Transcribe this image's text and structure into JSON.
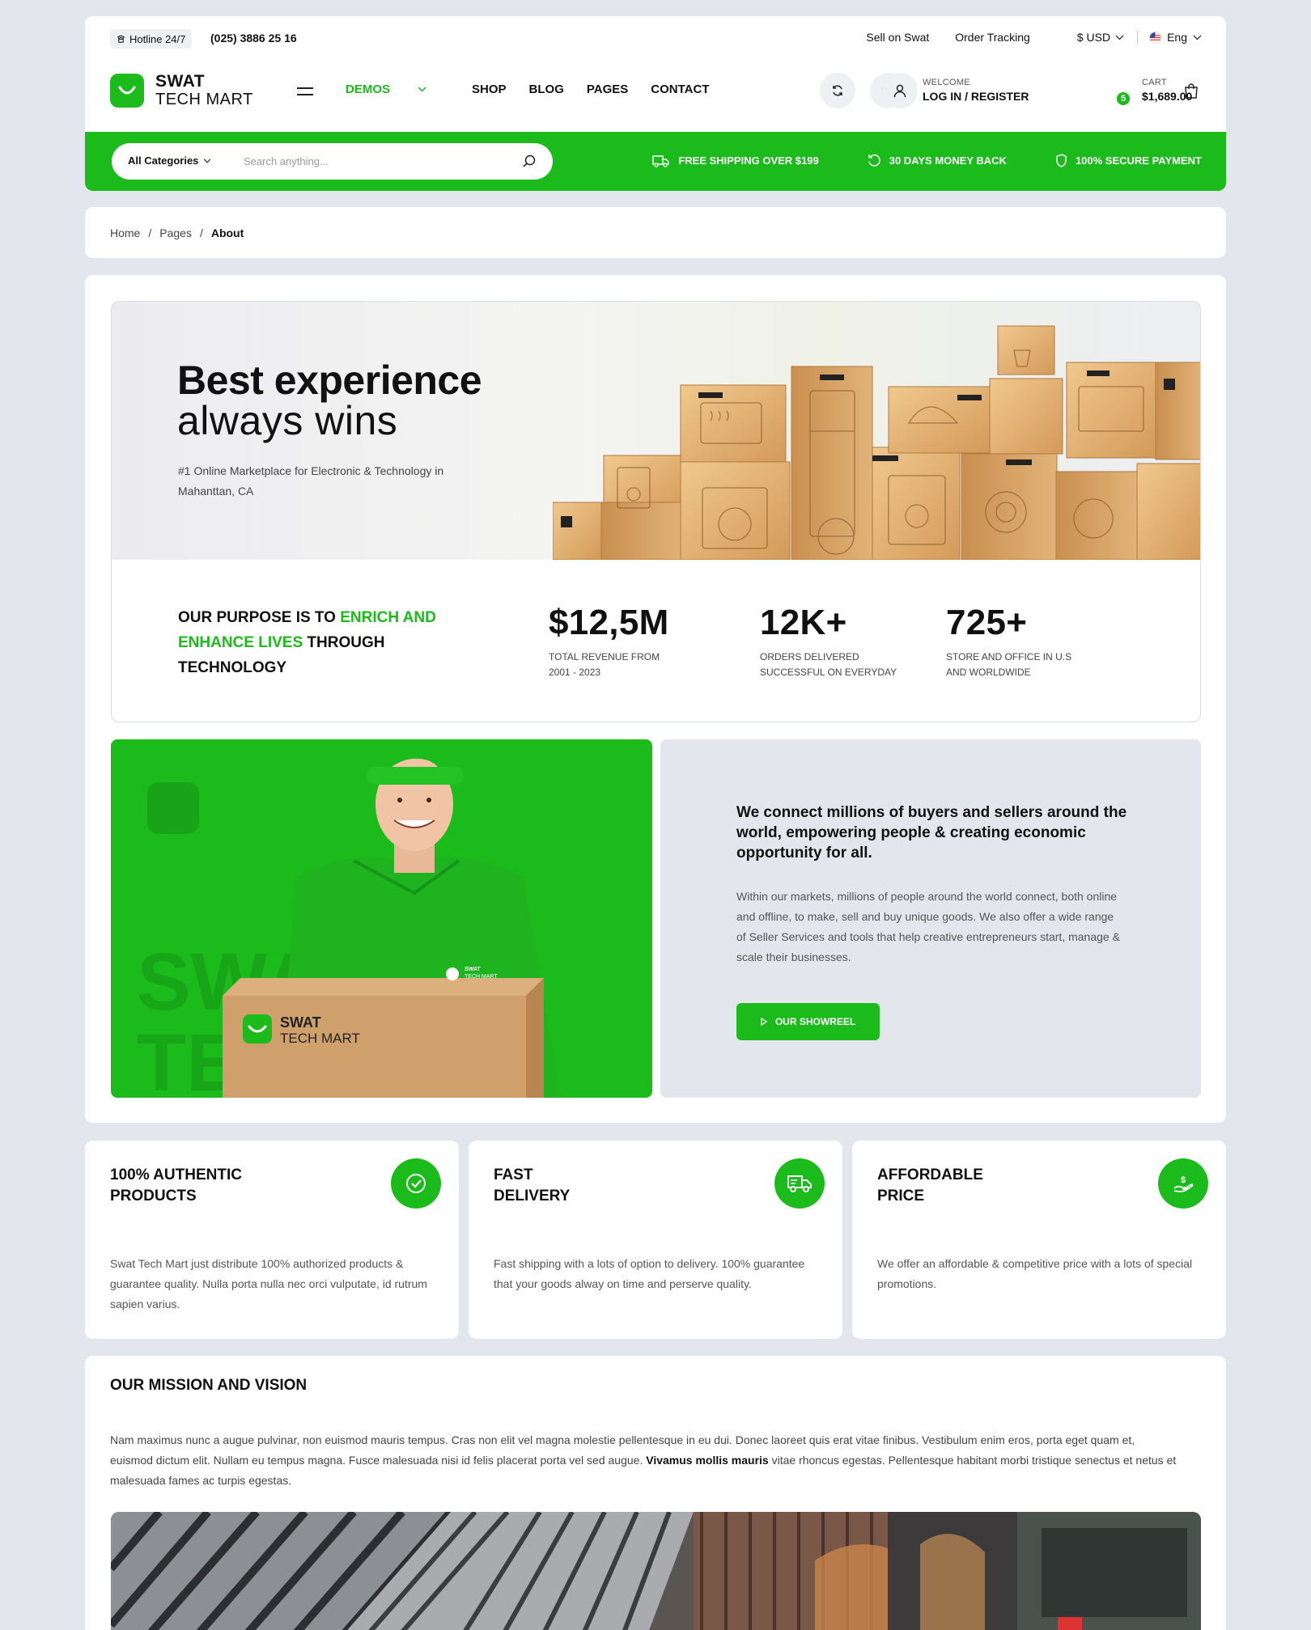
{
  "topbar": {
    "hotline_label": "Hotline 24/7",
    "hotline_number": "(025) 3886 25 16",
    "links": [
      "Sell on Swat",
      "Order Tracking"
    ],
    "currency": "$ USD",
    "language": "Eng"
  },
  "brand": {
    "name_line1": "SWAT",
    "name_line2": "TECH MART",
    "accent": "#1bbb1b"
  },
  "nav": {
    "demos": "DEMOS",
    "shop": "SHOP",
    "blog": "BLOG",
    "pages": "PAGES",
    "contact": "CONTACT"
  },
  "account": {
    "welcome": "WELCOME",
    "action": "LOG IN / REGISTER"
  },
  "cart": {
    "label": "CART",
    "total": "$1,689.00",
    "count": "5"
  },
  "search": {
    "category": "All Categories",
    "placeholder": "Search anything..."
  },
  "perks": [
    "FREE SHIPPING OVER $199",
    "30 DAYS MONEY BACK",
    "100% SECURE PAYMENT"
  ],
  "breadcrumb": {
    "home": "Home",
    "pages": "Pages",
    "current": "About",
    "sep": "/"
  },
  "hero": {
    "title_bold": "Best experience",
    "title_light": "always wins",
    "subtitle": "#1 Online Marketplace for Electronic & Technology in Mahanttan, CA"
  },
  "purpose": {
    "part1": "OUR PURPOSE IS TO ",
    "highlight": "ENRICH AND ENHANCE LIVES",
    "part2": " THROUGH TECHNOLOGY"
  },
  "stats": [
    {
      "value": "$12,5M",
      "label": "TOTAL REVENUE FROM 2001 - 2023"
    },
    {
      "value": "12K+",
      "label": "ORDERS DELIVERED SUCCESSFUL ON EVERYDAY"
    },
    {
      "value": "725+",
      "label": "STORE AND OFFICE IN U.S AND WORLDWIDE"
    }
  ],
  "promo": {
    "watermark": "SWAT TECH",
    "box_line1": "SWAT",
    "box_line2": "TECH MART",
    "shirt_line1": "SWAT",
    "shirt_line2": "TECH MART"
  },
  "connect": {
    "heading": "We connect millions of buyers and sellers around the world, empowering people & creating economic opportunity for all.",
    "body": "Within our markets, millions of people around the world connect, both online and offline, to make, sell and buy unique goods. We also offer a wide range of Seller Services and tools that help creative entrepreneurs start, manage & scale their businesses.",
    "button": "OUR SHOWREEL"
  },
  "features": [
    {
      "title": "100% AUTHENTIC\n PRODUCTS",
      "icon": "check-circle-icon",
      "desc": "Swat Tech Mart just distribute 100% authorized products & guarantee quality. Nulla porta nulla nec orci vulputate, id rutrum sapien varius."
    },
    {
      "title": "FAST\nDELIVERY",
      "icon": "truck-icon",
      "desc": "Fast shipping with a lots of option to delivery. 100% guarantee that your goods alway on time and perserve quality."
    },
    {
      "title": "AFFORDABLE\nPRICE",
      "icon": "price-hand-icon",
      "desc": "We offer an affordable & competitive price with a lots of special promotions."
    }
  ],
  "mission": {
    "title": "OUR MISSION AND VISION",
    "text_before": "Nam maximus nunc a augue pulvinar, non euismod mauris tempus. Cras non elit vel magna molestie pellentesque in eu dui. Donec laoreet quis erat vitae finibus. Vestibulum enim eros, porta eget quam et, euismod dictum elit. Nullam eu tempus magna. Fusce malesuada nisi id felis placerat porta vel sed augue. ",
    "text_bold": "Vivamus mollis mauris",
    "text_after": " vitae rhoncus egestas. Pellentesque habitant morbi tristique senectus et netus et malesuada fames ac turpis egestas."
  }
}
